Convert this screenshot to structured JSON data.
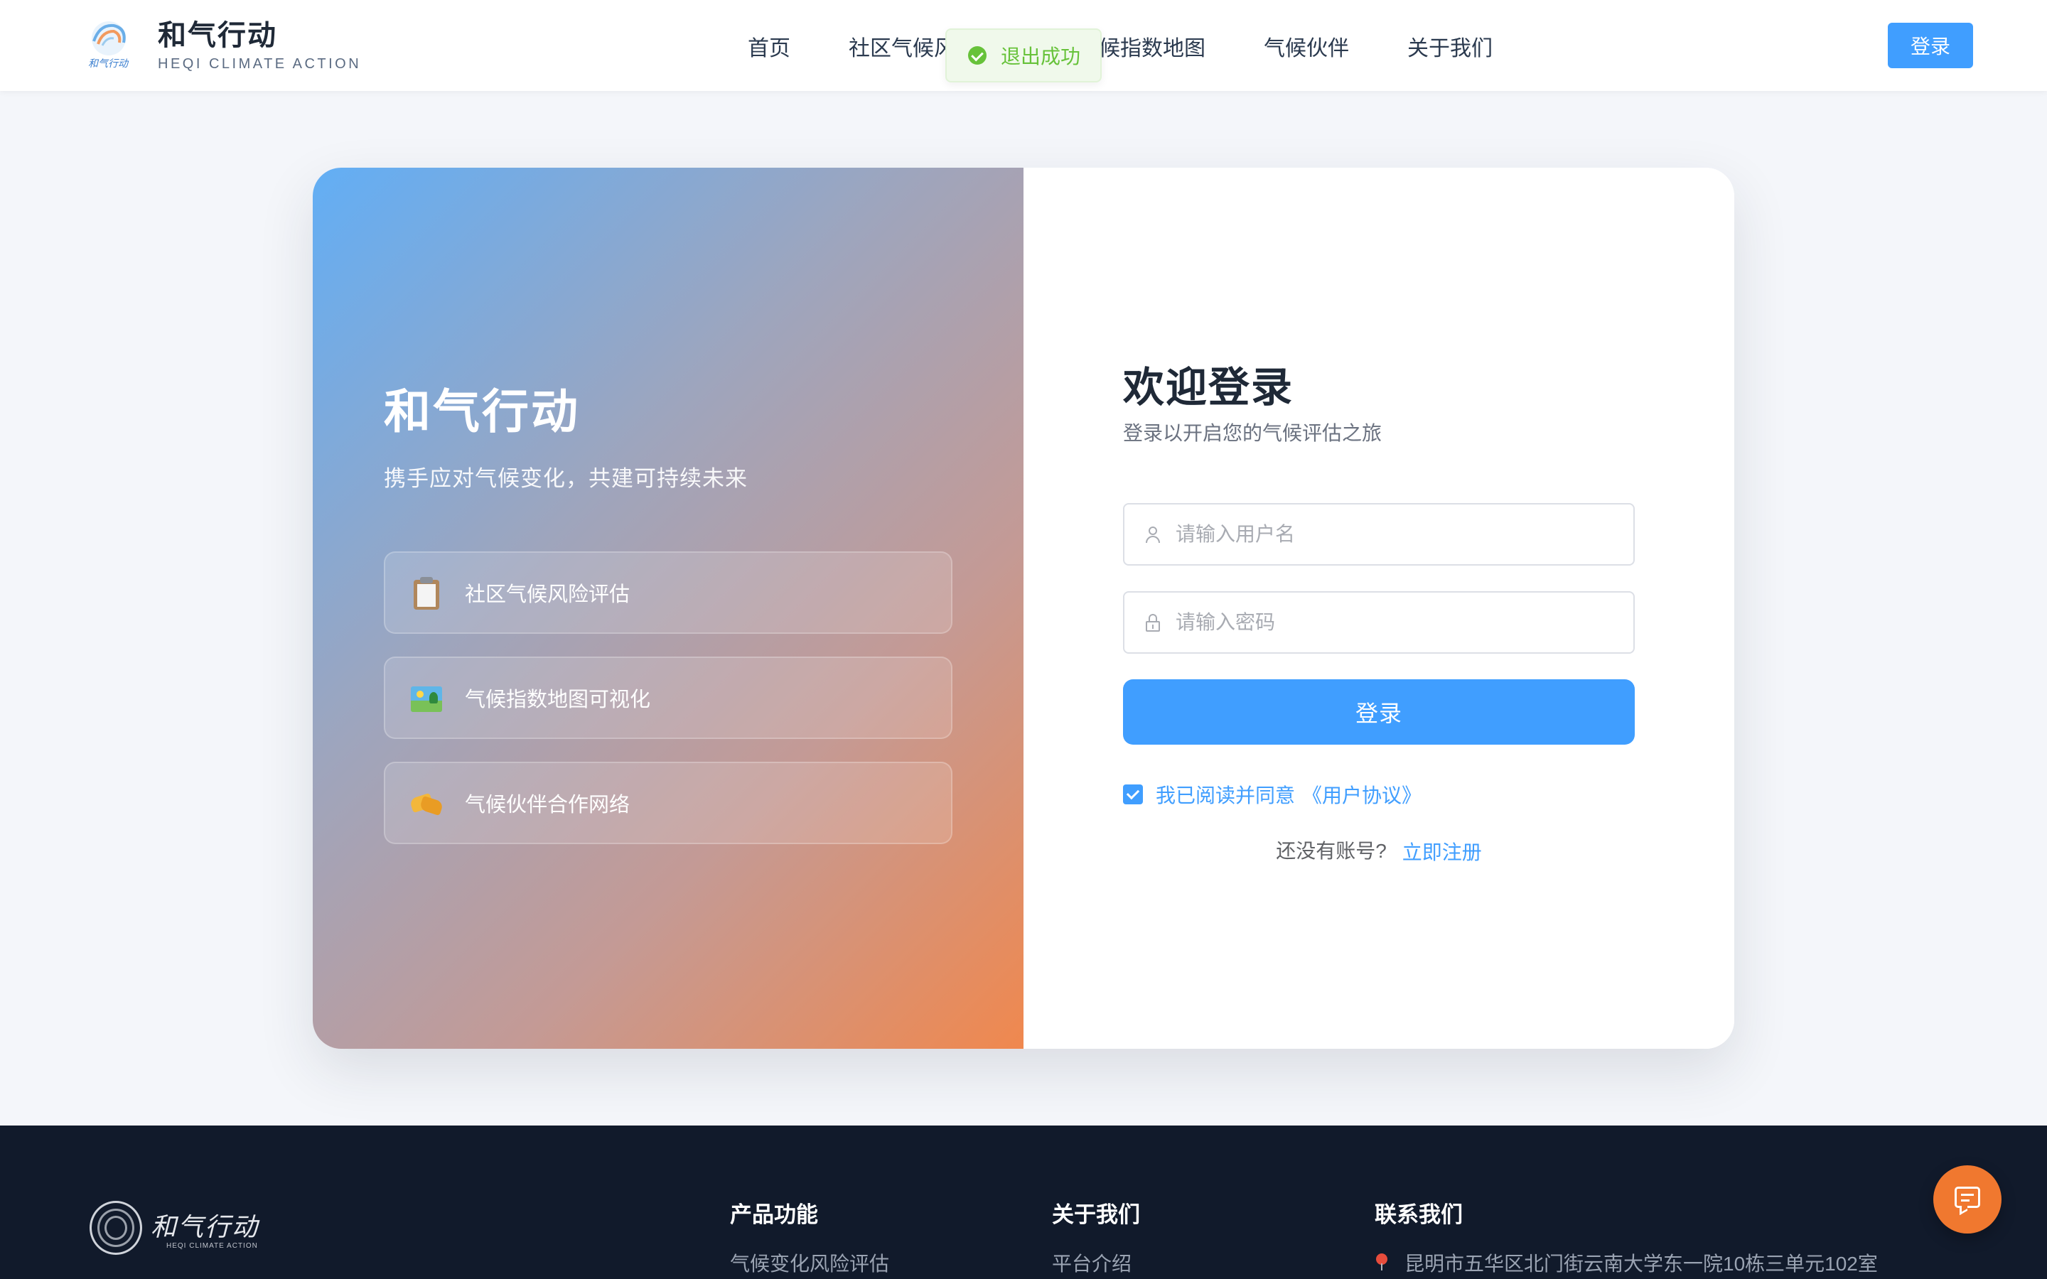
{
  "brand": {
    "name": "和气行动",
    "subtitle": "HEQI CLIMATE ACTION"
  },
  "nav": {
    "items": [
      {
        "label": "首页"
      },
      {
        "label": "社区气候风险评估"
      },
      {
        "label": "气候指数地图"
      },
      {
        "label": "气候伙伴"
      },
      {
        "label": "关于我们"
      }
    ],
    "login_label": "登录"
  },
  "toast": {
    "message": "退出成功",
    "type": "success",
    "color": "#67c23a"
  },
  "hero": {
    "title": "和气行动",
    "subtitle": "携手应对气候变化，共建可持续未来",
    "features": [
      {
        "icon": "clipboard-icon",
        "label": "社区气候风险评估"
      },
      {
        "icon": "map-icon",
        "label": "气候指数地图可视化"
      },
      {
        "icon": "handshake-icon",
        "label": "气候伙伴合作网络"
      }
    ]
  },
  "login": {
    "title": "欢迎登录",
    "subtitle": "登录以开启您的气候评估之旅",
    "username_placeholder": "请输入用户名",
    "username_value": "",
    "password_placeholder": "请输入密码",
    "password_value": "",
    "submit_label": "登录",
    "agree_checked": true,
    "agree_text": "我已阅读并同意",
    "agreement_link": "《用户协议》",
    "register_question": "还没有账号?",
    "register_link": "立即注册"
  },
  "footer": {
    "logo_text": "和气行动",
    "logo_sub": "HEQI CLIMATE ACTION",
    "columns": [
      {
        "title": "产品功能",
        "items": [
          "气候变化风险评估"
        ]
      },
      {
        "title": "关于我们",
        "items": [
          "平台介绍"
        ]
      },
      {
        "title": "联系我们",
        "items": [
          "昆明市五华区北门街云南大学东一院10栋三单元102室"
        ]
      }
    ]
  },
  "colors": {
    "primary": "#409eff",
    "accent": "#f0782f",
    "footer_bg": "#111a2b"
  }
}
